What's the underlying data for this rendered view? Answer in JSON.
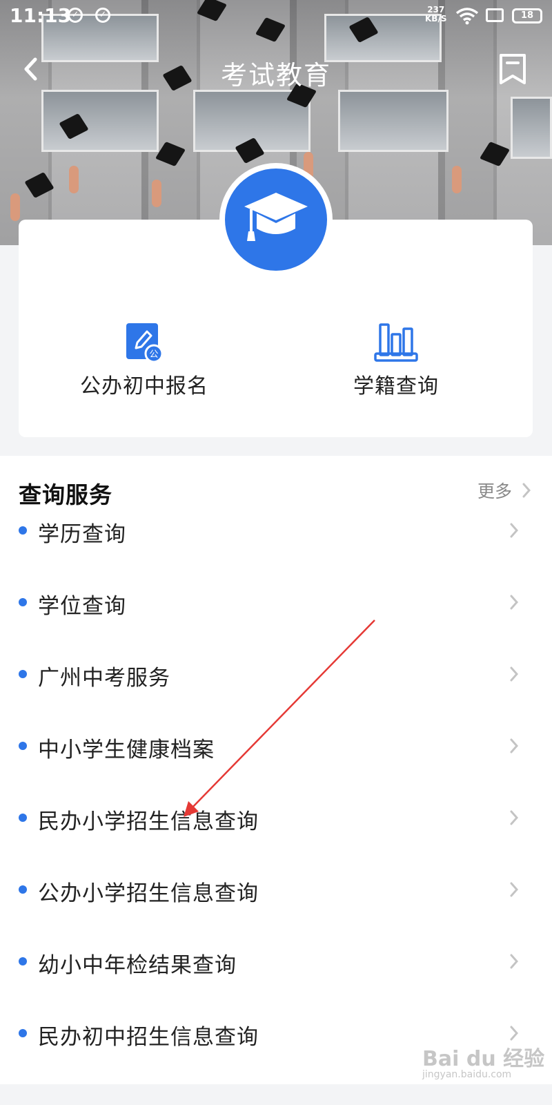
{
  "status_bar": {
    "time": "11:13",
    "net_speed_value": "237",
    "net_speed_unit": "KB/S",
    "battery": "18"
  },
  "nav": {
    "title": "考试教育",
    "back_icon": "chevron-left-icon",
    "bookmark_icon": "bookmark-icon"
  },
  "quick_actions": [
    {
      "label": "公办初中报名",
      "icon": "edit-document-icon"
    },
    {
      "label": "学籍查询",
      "icon": "bar-chart-icon"
    }
  ],
  "services": {
    "title": "查询服务",
    "more": "更多",
    "items": [
      {
        "label": "学历查询"
      },
      {
        "label": "学位查询"
      },
      {
        "label": "广州中考服务"
      },
      {
        "label": "中小学生健康档案"
      },
      {
        "label": "民办小学招生信息查询"
      },
      {
        "label": "公办小学招生信息查询"
      },
      {
        "label": "幼小中年检结果查询"
      },
      {
        "label": "民办初中招生信息查询"
      }
    ]
  },
  "watermark": {
    "text": "Bai du 经验",
    "sub": "jingyan.baidu.com"
  },
  "colors": {
    "accent": "#2e76e8",
    "annotation_arrow": "#e53935"
  }
}
